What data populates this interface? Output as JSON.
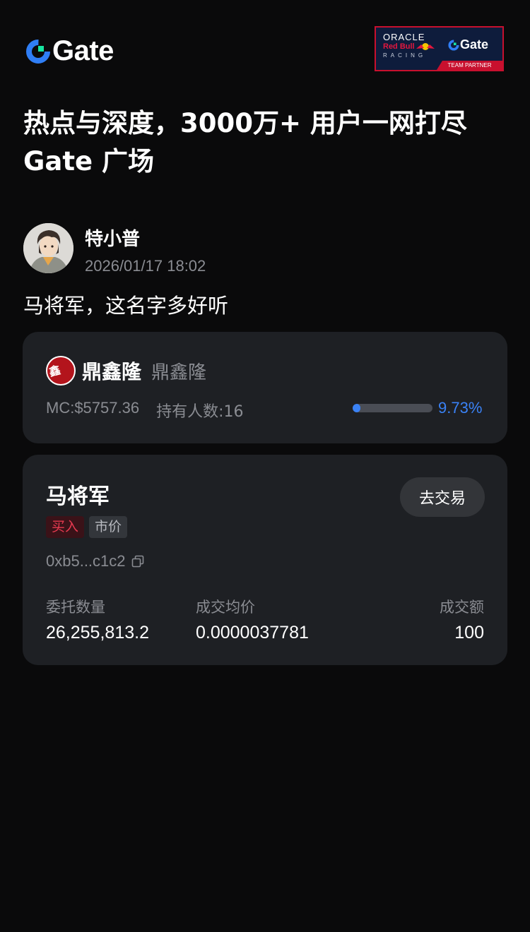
{
  "brand": {
    "name": "Gate",
    "logo_icon": "gate-logo-icon",
    "accent": "#2f7ef5"
  },
  "partner_badge": {
    "line1": "ORACLE",
    "line2": "Red Bull",
    "line3": "RACING",
    "brand": "Gate",
    "band": "TEAM PARTNER"
  },
  "headline": {
    "line1": "热点与深度，3000万+ 用户一网打尽",
    "line2": "Gate 广场"
  },
  "post": {
    "author_name": "特小普",
    "timestamp": "2026/01/17 18:02",
    "text": "马将军，这名字多好听"
  },
  "token": {
    "name": "鼎鑫隆",
    "symbol": "鼎鑫隆",
    "market_cap": "MC:$5757.36",
    "holders": "持有人数:16",
    "progress_percent": "9.73%",
    "progress_fraction": 0.0973,
    "progress_color": "#3a82f6"
  },
  "trade": {
    "title": "马将军",
    "action_label": "去交易",
    "tags": [
      "买入",
      "市价"
    ],
    "address": "0xb5...c1c2",
    "stats": [
      {
        "label": "委托数量",
        "value": "26,255,813.2"
      },
      {
        "label": "成交均价",
        "value": "0.0000037781"
      },
      {
        "label": "成交额",
        "value": "100"
      }
    ],
    "buy_color": "#e83a50"
  }
}
